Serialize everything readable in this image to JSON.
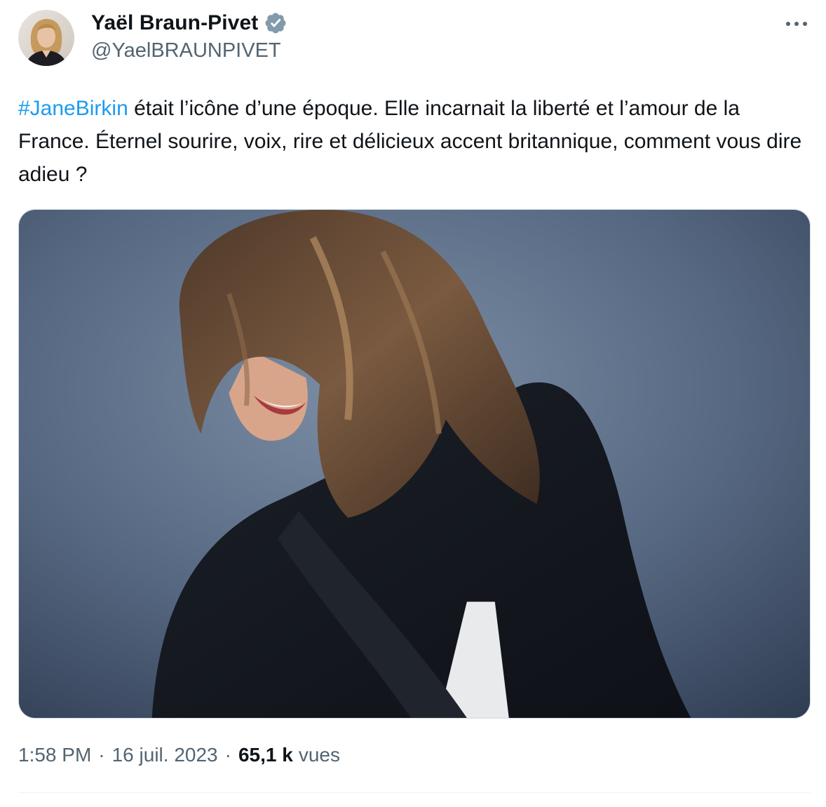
{
  "author": {
    "display_name": "Yaël Braun-Pivet",
    "handle": "@YaelBRAUNPIVET",
    "verified_icon": "verified-badge-icon",
    "badge_color": "#829aab"
  },
  "menu": {
    "more_icon": "more-horizontal-icon"
  },
  "tweet": {
    "hashtag": "#JaneBirkin",
    "text": " était l’icône d’une époque. Elle incarnait la liberté et l’amour de la France. Éternel sourire, voix, rire et délicieux accent britannique, comment vous dire adieu ?",
    "hashtag_color": "#1d9bf0",
    "media_description_icon": "photo-image-icon"
  },
  "meta": {
    "time": "1:58 PM",
    "separator": "·",
    "date": "16 juil. 2023",
    "views_count": "65,1 k",
    "views_label": "vues"
  },
  "colors": {
    "text_primary": "#0f1419",
    "text_secondary": "#536471",
    "border": "#cfd9de"
  }
}
